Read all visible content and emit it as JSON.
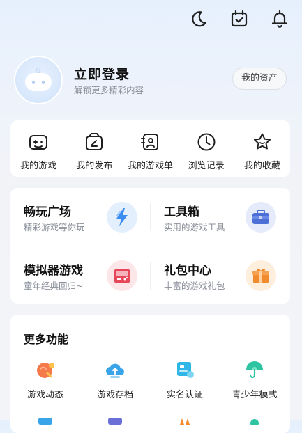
{
  "topbar": {
    "icons": [
      "moon-icon",
      "calendar-check-icon",
      "bell-icon"
    ]
  },
  "profile": {
    "title": "立即登录",
    "subtitle": "解锁更多精彩内容",
    "assets_button": "我的资产"
  },
  "quick_links": [
    {
      "label": "我的游戏",
      "icon": "gamepad-icon"
    },
    {
      "label": "我的发布",
      "icon": "edit-publish-icon"
    },
    {
      "label": "我的游戏单",
      "icon": "game-list-icon"
    },
    {
      "label": "浏览记录",
      "icon": "clock-icon"
    },
    {
      "label": "我的收藏",
      "icon": "star-icon"
    }
  ],
  "services": [
    {
      "title": "畅玩广场",
      "subtitle": "精彩游戏等你玩",
      "icon": "lightning-icon",
      "color": "#3a8cf0"
    },
    {
      "title": "工具箱",
      "subtitle": "实用的游戏工具",
      "icon": "toolbox-icon",
      "color": "#4b6fd6"
    },
    {
      "title": "模拟器游戏",
      "subtitle": "童年经典回归~",
      "icon": "emulator-icon",
      "color": "#e6485a"
    },
    {
      "title": "礼包中心",
      "subtitle": "丰富的游戏礼包",
      "icon": "gift-icon",
      "color": "#f28a2e"
    }
  ],
  "more": {
    "title": "更多功能",
    "items": [
      {
        "label": "游戏动态",
        "icon": "game-news-icon",
        "color": "#f57a4a"
      },
      {
        "label": "游戏存档",
        "icon": "cloud-save-icon",
        "color": "#3aa4e8"
      },
      {
        "label": "实名认证",
        "icon": "id-card-icon",
        "color": "#2fb6e6"
      },
      {
        "label": "青少年模式",
        "icon": "umbrella-icon",
        "color": "#2ec4a2"
      }
    ]
  }
}
